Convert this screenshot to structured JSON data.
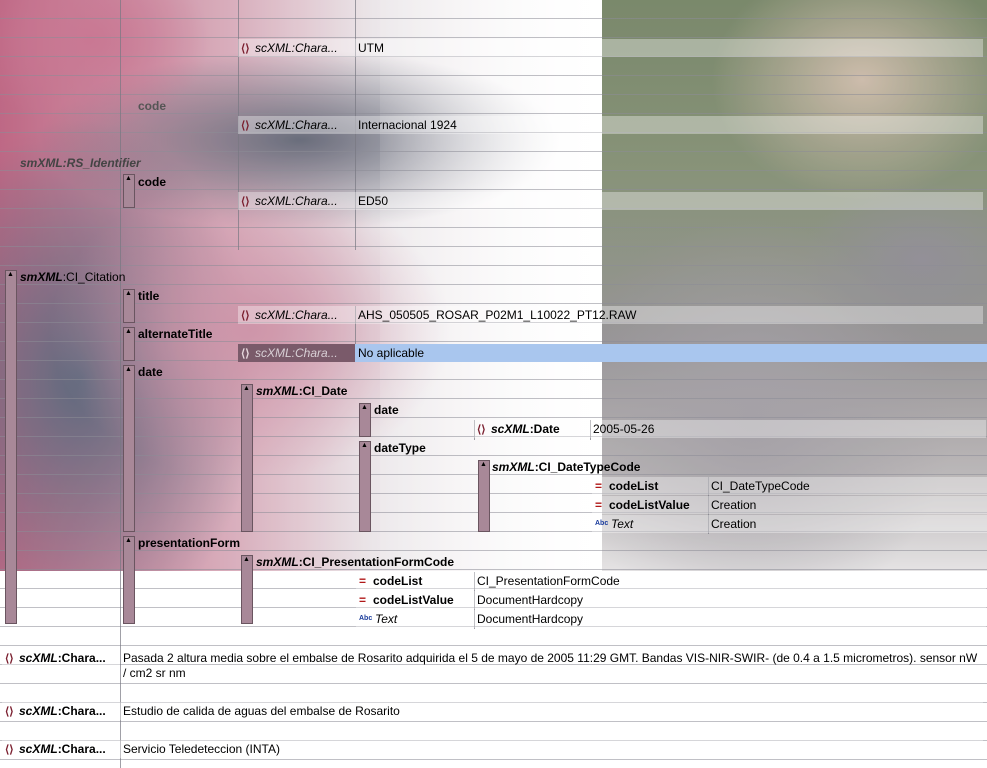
{
  "lines": {
    "r1": {
      "tag": "scXML:Chara...",
      "value": "UTM"
    },
    "r2_label": "code",
    "r3": {
      "tag": "scXML:Chara...",
      "value": "Internacional 1924"
    },
    "rs_identifier": "smXML:RS_Identifier",
    "code_label": "code",
    "r4": {
      "tag": "scXML:Chara...",
      "value": "ED50"
    },
    "ci_citation": {
      "ns": "smXML",
      "rest": ":CI_Citation"
    },
    "title_label": "title",
    "title_val": {
      "tag": "scXML:Chara...",
      "value": "AHS_050505_ROSAR_P02M1_L10022_PT12.RAW"
    },
    "alt_label": "alternateTitle",
    "alt_val": {
      "tag": "scXML:Chara...",
      "value": "No aplicable"
    },
    "date_label": "date",
    "ci_date": {
      "ns": "smXML",
      "rest": ":CI_Date"
    },
    "date_inner_label": "date",
    "date_val": {
      "ns": "scXML",
      "rest": ":Date",
      "value": "2005-05-26"
    },
    "datetype_label": "dateType",
    "ci_datetypecode": {
      "ns": "smXML",
      "rest": ":CI_DateTypeCode"
    },
    "dt_codelist": {
      "name": "codeList",
      "value": "CI_DateTypeCode"
    },
    "dt_codelistvalue": {
      "name": "codeListValue",
      "value": "Creation"
    },
    "dt_text": {
      "name": "Text",
      "value": "Creation"
    },
    "pres_label": "presentationForm",
    "ci_pres": {
      "ns": "smXML",
      "rest": ":CI_PresentationFormCode"
    },
    "pf_codelist": {
      "name": "codeList",
      "value": "CI_PresentationFormCode"
    },
    "pf_codelistvalue": {
      "name": "codeListValue",
      "value": "DocumentHardcopy"
    },
    "pf_text": {
      "name": "Text",
      "value": "DocumentHardcopy"
    },
    "abstract": {
      "ns": "scXML",
      "rest": ":Chara...",
      "value": "Pasada 2 altura media sobre el embalse de Rosarito adquirida el 5 de mayo de 2005 11:29 GMT. Bandas VIS-NIR-SWIR- (de 0.4 a 1.5 micrometros). sensor nW / cm2 sr nm"
    },
    "purpose": {
      "ns": "scXML",
      "rest": ":Chara...",
      "value": "Estudio de calida de aguas del embalse de Rosarito"
    },
    "credit": {
      "ns": "scXML",
      "rest": ":Chara...",
      "value": "Servicio Teledeteccion (INTA)"
    }
  },
  "icons": {
    "element": "element-brace-icon",
    "attribute": "attribute-equals-icon",
    "text": "abc-text-icon"
  }
}
